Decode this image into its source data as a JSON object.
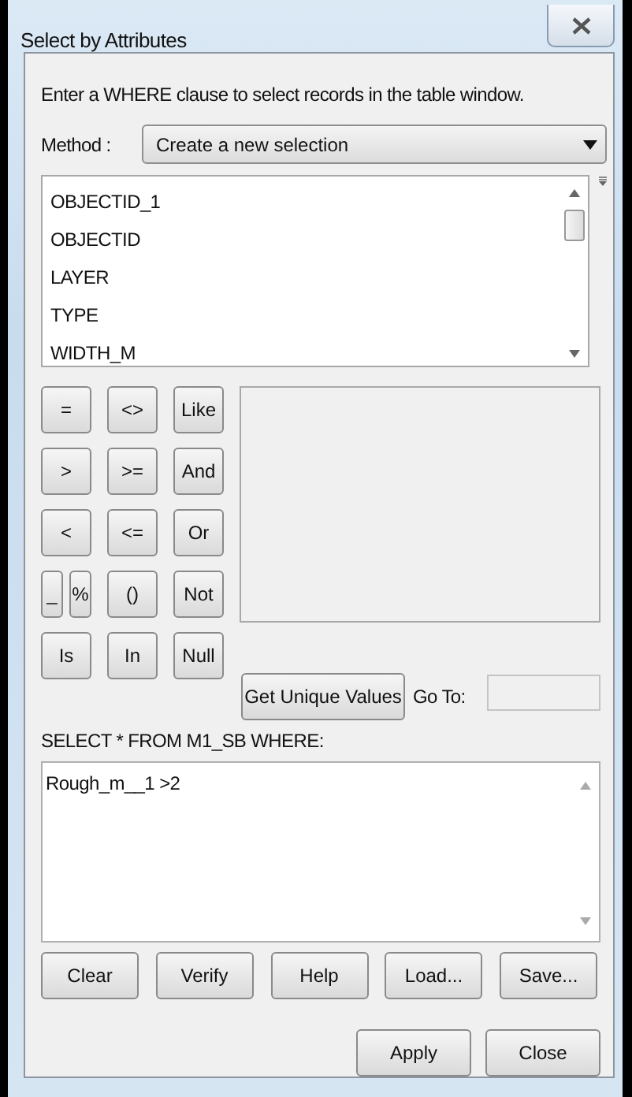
{
  "window": {
    "title": "Select by Attributes"
  },
  "instruction": "Enter a WHERE clause to select records in the table window.",
  "method": {
    "label": "Method :",
    "value": "Create a new selection"
  },
  "fields": [
    "OBJECTID_1",
    "OBJECTID",
    "LAYER",
    "TYPE",
    "WIDTH_M"
  ],
  "operators": [
    [
      {
        "label": "=",
        "kind": "full"
      },
      {
        "label": "<>",
        "kind": "full"
      },
      {
        "label": "Like",
        "kind": "full"
      }
    ],
    [
      {
        "label": ">",
        "kind": "full"
      },
      {
        "label": ">=",
        "kind": "full"
      },
      {
        "label": "And",
        "kind": "full"
      }
    ],
    [
      {
        "label": "<",
        "kind": "full"
      },
      {
        "label": "<=",
        "kind": "full"
      },
      {
        "label": "Or",
        "kind": "full"
      }
    ],
    [
      {
        "label": "_",
        "kind": "half"
      },
      {
        "label": "%",
        "kind": "half"
      },
      {
        "label": "()",
        "kind": "full"
      },
      {
        "label": "Not",
        "kind": "full"
      }
    ],
    [
      {
        "label": "Is",
        "kind": "full"
      },
      {
        "label": "In",
        "kind": "full"
      },
      {
        "label": "Null",
        "kind": "full"
      }
    ]
  ],
  "unique_values_button": "Get Unique Values",
  "goto_label": "Go To:",
  "query_label": "SELECT * FROM M1_SB WHERE:",
  "expression": "Rough_m__1 >2",
  "buttons": [
    "Clear",
    "Verify",
    "Help",
    "Load...",
    "Save..."
  ],
  "dialog_buttons": [
    "Apply",
    "Close"
  ]
}
